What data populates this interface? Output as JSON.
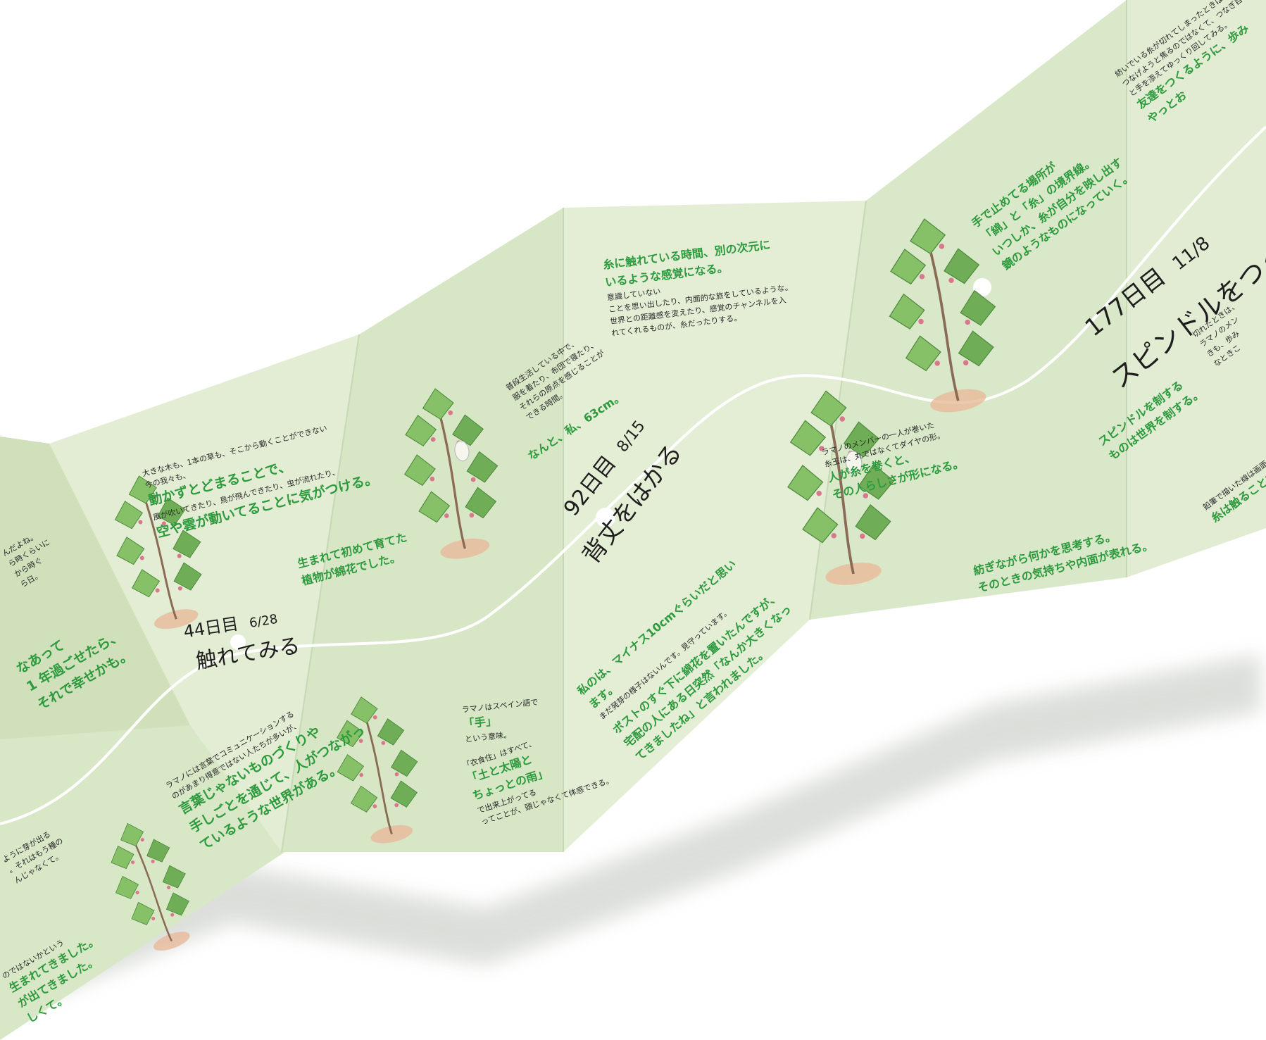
{
  "colors": {
    "paper_light": "#e4eed5",
    "paper_mid": "#d9e8c8",
    "paper_dark": "#cfe0bd",
    "accent_green": "#2e9a3e",
    "ink": "#1e1e1e"
  },
  "panels": [
    {
      "id": "p0",
      "lines": [
        {
          "cls": "gr",
          "txt": "なあって"
        },
        {
          "cls": "gr",
          "txt": "1 年過ごせたら、"
        },
        {
          "cls": "gr",
          "txt": "それで幸せかも。"
        }
      ]
    },
    {
      "id": "p1a",
      "lines": [
        {
          "cls": "sm",
          "txt": "大きな木も、1本の草も、そこから動くことができない"
        },
        {
          "cls": "sm",
          "txt": "今の我々も、"
        },
        {
          "cls": "gr",
          "txt": "動かずとどまることで、"
        },
        {
          "cls": "sm",
          "txt": "風が吹いてきたり、鳥が飛んできたり、虫が流れたり、"
        },
        {
          "cls": "gr",
          "txt": "空や雲が動いてることに気がつける。"
        }
      ]
    },
    {
      "id": "p1b",
      "lines": [
        {
          "cls": "gr2",
          "txt": "生まれて初めて育てた"
        },
        {
          "cls": "gr2",
          "txt": "植物が綿花でした。"
        }
      ]
    },
    {
      "id": "p1c",
      "lines": [
        {
          "cls": "sm",
          "txt": "ラマノには言葉でコミュニケーションする"
        },
        {
          "cls": "sm",
          "txt": "のがあまり得意ではない人たちが多いが、"
        },
        {
          "cls": "gr",
          "txt": "言葉じゃないものづくりや"
        },
        {
          "cls": "gr",
          "txt": "手しごとを通じて、人がつながっ"
        },
        {
          "cls": "gr",
          "txt": "ているような世界がある。"
        }
      ]
    },
    {
      "id": "p2a",
      "lines": [
        {
          "cls": "sm",
          "txt": "普段生活している中で、"
        },
        {
          "cls": "sm",
          "txt": "服を着たり、布団で寝たり、"
        },
        {
          "cls": "sm",
          "txt": "それらの原点を感じることが"
        },
        {
          "cls": "sm",
          "txt": "できる時間。"
        }
      ]
    },
    {
      "id": "p2b",
      "lines": [
        {
          "cls": "gr2",
          "txt": "なんと、私、63cm。"
        }
      ]
    },
    {
      "id": "p2c",
      "lines": [
        {
          "cls": "sm",
          "txt": "ラマノはスペイン語で"
        },
        {
          "cls": "gr2",
          "txt": "「手」"
        },
        {
          "cls": "sm",
          "txt": "という意味。"
        }
      ]
    },
    {
      "id": "p2d",
      "lines": [
        {
          "cls": "sm",
          "txt": "「衣食住」はすべて、"
        },
        {
          "cls": "gr2",
          "txt": "「土と太陽と"
        },
        {
          "cls": "gr2",
          "txt": "ちょっとの雨」"
        },
        {
          "cls": "sm",
          "txt": "で出来上がってる"
        },
        {
          "cls": "sm",
          "txt": "ってことが、頭じゃなくて体感できる。"
        }
      ]
    },
    {
      "id": "p3a",
      "lines": [
        {
          "cls": "gr2",
          "txt": "糸に触れている時間、別の次元に"
        },
        {
          "cls": "gr2",
          "txt": "いるような感覚になる。"
        },
        {
          "cls": "sm",
          "txt": "意識していない"
        },
        {
          "cls": "sm",
          "txt": "ことを思い出したり、内面的な旅をしているような。"
        },
        {
          "cls": "sm",
          "txt": "世界との距離感を変えたり、感覚のチャンネルを入"
        },
        {
          "cls": "sm",
          "txt": "れてくれるものが、糸だったりする。"
        }
      ]
    },
    {
      "id": "p3b",
      "lines": [
        {
          "cls": "gr2",
          "txt": "私のは、マイナス10cmぐらいだと思い"
        },
        {
          "cls": "gr2",
          "txt": "ます。"
        },
        {
          "cls": "sm",
          "txt": "まだ発芽の様子はないんです。見守っています。"
        }
      ]
    },
    {
      "id": "p3c",
      "lines": [
        {
          "cls": "gr2",
          "txt": "ポストのすぐ下に綿花を置いたんですが、"
        },
        {
          "cls": "gr2",
          "txt": "宅配の人にある日突然「なんか大きくなっ"
        },
        {
          "cls": "gr2",
          "txt": "てきましたね」と言われました。"
        }
      ]
    },
    {
      "id": "p4a",
      "lines": [
        {
          "cls": "sm",
          "txt": "ラマノのメンバーの一人が巻いた"
        },
        {
          "cls": "sm",
          "txt": "糸玉は、丸ではなくてダイヤの形。"
        },
        {
          "cls": "gr2",
          "txt": "人が糸を巻くと、"
        },
        {
          "cls": "gr2",
          "txt": "その人らしさが形になる。"
        }
      ]
    },
    {
      "id": "p4b",
      "lines": [
        {
          "cls": "gr2",
          "txt": "紡ぎながら何かを思考する。"
        },
        {
          "cls": "gr2",
          "txt": "そのときの気持ちや内面が表れる。"
        }
      ]
    },
    {
      "id": "p5a",
      "lines": [
        {
          "cls": "gr2",
          "txt": "手で止めてる場所が"
        },
        {
          "cls": "gr2",
          "txt": "「綿」と「糸」の境界線。"
        },
        {
          "cls": "gr2",
          "txt": " "
        },
        {
          "cls": "gr2",
          "txt": "いつしか、糸が自分を映し出す"
        },
        {
          "cls": "gr2",
          "txt": "鏡のようなものになっていく。"
        }
      ]
    },
    {
      "id": "p5b",
      "lines": [
        {
          "cls": "gr2",
          "txt": "スピンドルを制する"
        },
        {
          "cls": "gr2",
          "txt": "ものは世界を制する。"
        }
      ]
    },
    {
      "id": "p6a",
      "lines": [
        {
          "cls": "sm",
          "txt": "紡いでいる糸が切れてしまったときは、無理"
        },
        {
          "cls": "sm",
          "txt": "つなげようと焦るのではなくて、つなぎ目"
        },
        {
          "cls": "sm",
          "txt": "と手を添えてゆっくり回してみる。"
        },
        {
          "cls": "gr2",
          "txt": "友達をつくるように、歩み"
        },
        {
          "cls": "gr2",
          "txt": " "
        },
        {
          "cls": "gr2",
          "txt": "やっとお"
        }
      ]
    },
    {
      "id": "p6b",
      "lines": [
        {
          "cls": "sm",
          "txt": "切れたときは、"
        },
        {
          "cls": "sm",
          "txt": "ラマノのメン"
        },
        {
          "cls": "sm",
          "txt": "きも、歩み"
        },
        {
          "cls": "sm",
          "txt": "なときこ"
        }
      ]
    },
    {
      "id": "p6c",
      "lines": [
        {
          "cls": "sm",
          "txt": "鉛筆で描いた線は画面の"
        },
        {
          "cls": "gr2",
          "txt": "糸は触ることで"
        }
      ]
    },
    {
      "id": "p0b",
      "lines": [
        {
          "cls": "sm",
          "txt": "んだよね。"
        },
        {
          "cls": "sm",
          "txt": "ら時くらいに"
        },
        {
          "cls": "sm",
          "txt": "から時ぐ"
        },
        {
          "cls": "sm",
          "txt": "ら日。"
        }
      ]
    },
    {
      "id": "p0c",
      "lines": [
        {
          "cls": "sm",
          "txt": "ように芽が出る"
        },
        {
          "cls": "sm",
          "txt": "。それはもう種の"
        },
        {
          "cls": "sm",
          "txt": "んじゃなくて。"
        }
      ]
    },
    {
      "id": "p0d",
      "lines": [
        {
          "cls": "sm",
          "txt": "のではないかという"
        },
        {
          "cls": "gr2",
          "txt": "生まれてきました。"
        },
        {
          "cls": "gr2",
          "txt": " "
        },
        {
          "cls": "gr2",
          "txt": "が出てきました。"
        },
        {
          "cls": "gr2",
          "txt": "しくて。"
        }
      ]
    }
  ],
  "handwritten": [
    {
      "id": "h44",
      "day": "44日目",
      "date": "6/28",
      "title": "触れてみる"
    },
    {
      "id": "h92",
      "day": "92日目",
      "date": "8/15",
      "title": "背丈をはかる"
    },
    {
      "id": "h177",
      "day": "177日目",
      "date": "11/8",
      "title": "スピンドルをつくる"
    }
  ]
}
